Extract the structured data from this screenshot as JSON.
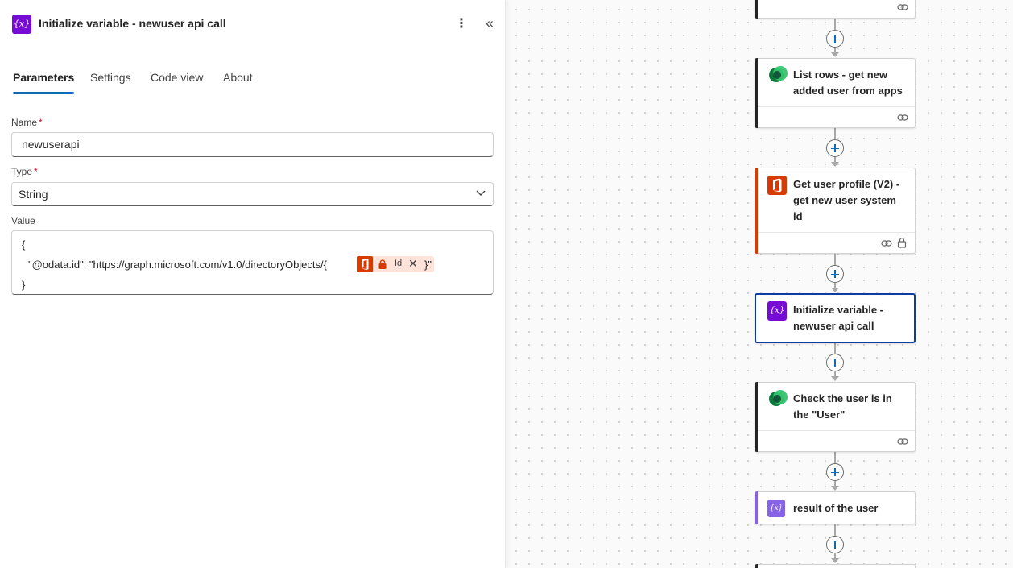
{
  "panel": {
    "title": "Initialize variable - newuser api call",
    "icon": "variable-icon",
    "accent": "#770bd6",
    "menu_icon": "more-vertical-icon",
    "collapse_icon": "collapse-panel-icon",
    "collapse_glyph": "«",
    "menu_glyph": "⋮",
    "icon_glyph": "{x}"
  },
  "tabs": [
    {
      "label": "Parameters",
      "active": true
    },
    {
      "label": "Settings",
      "active": false
    },
    {
      "label": "Code view",
      "active": false
    },
    {
      "label": "About",
      "active": false
    }
  ],
  "form": {
    "name_label": "Name",
    "name_value": "newuserapi",
    "type_label": "Type",
    "type_value": "String",
    "value_label": "Value",
    "required_mark": "*",
    "value_line1": "{",
    "value_line2": "\"@odata.id\": \"https://graph.microsoft.com/v1.0/directoryObjects/{",
    "value_line2_end": "}\"",
    "value_line3": "}",
    "token_label": "Id",
    "token_remove": "✕",
    "token_color": "#d83b01"
  },
  "flow": {
    "cards": [
      {
        "title": "",
        "accent": "#242424",
        "icon": "none",
        "footer_icons": [
          "link-icon"
        ]
      },
      {
        "title": "List rows - get new added user from apps",
        "accent": "#242424",
        "icon": "dataverse-icon",
        "footer_icons": [
          "link-icon"
        ]
      },
      {
        "title": "Get user profile (V2) - get new user system id",
        "accent": "#d83b01",
        "icon": "office365-icon",
        "footer_icons": [
          "link-icon",
          "lock-icon"
        ]
      },
      {
        "title": "Initialize variable - newuser api call",
        "accent": "#770bd6",
        "icon": "variable-icon",
        "selected": true
      },
      {
        "title": "Check the user is in the \"User\"",
        "accent": "#242424",
        "icon": "dataverse-icon",
        "footer_icons": [
          "link-icon"
        ]
      },
      {
        "title": "result of the user",
        "accent": "#8764e6",
        "icon": "variable-icon"
      }
    ],
    "add_button_icon": "plus-icon",
    "brand_blue": "#0f6cbd"
  }
}
